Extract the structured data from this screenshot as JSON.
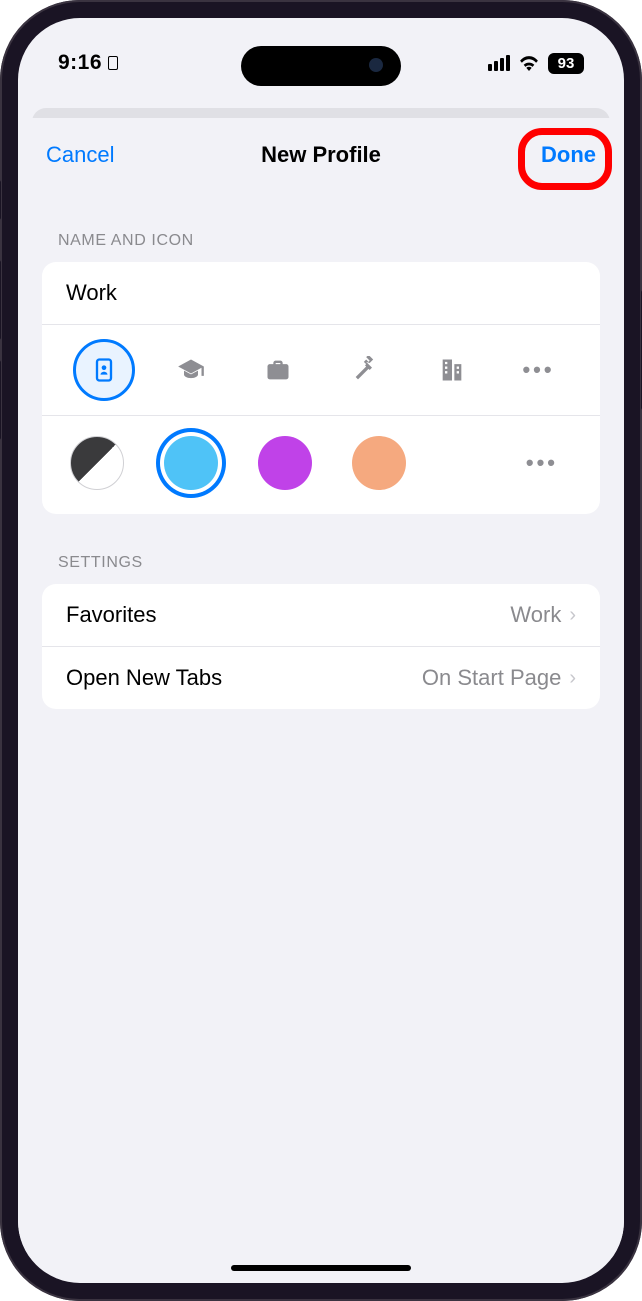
{
  "status": {
    "time": "9:16",
    "battery": "93"
  },
  "nav": {
    "cancel": "Cancel",
    "title": "New Profile",
    "done": "Done"
  },
  "sections": {
    "nameIcon": "NAME AND ICON",
    "settings": "SETTINGS"
  },
  "profile": {
    "name": "Work"
  },
  "icons": {
    "more": "•••"
  },
  "colors": {
    "blue": "#4fc3f7",
    "purple": "#c042e8",
    "orange": "#f5a97f",
    "more": "•••"
  },
  "settingsRows": {
    "favorites": {
      "label": "Favorites",
      "value": "Work"
    },
    "openNewTabs": {
      "label": "Open New Tabs",
      "value": "On Start Page"
    }
  }
}
